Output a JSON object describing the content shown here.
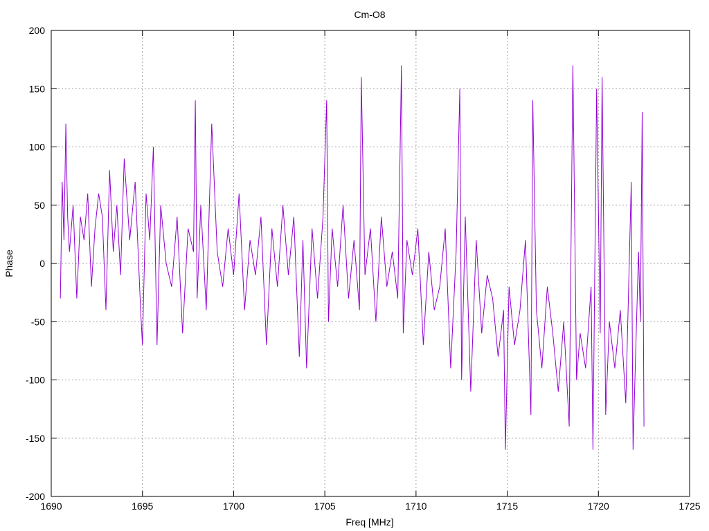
{
  "chart_data": {
    "type": "line",
    "title": "Cm-O8",
    "xlabel": "Freq [MHz]",
    "ylabel": "Phase",
    "xlim": [
      1690,
      1725
    ],
    "ylim": [
      -200,
      200
    ],
    "x_ticks": [
      1690,
      1695,
      1700,
      1705,
      1710,
      1715,
      1720,
      1725
    ],
    "y_ticks": [
      -200,
      -150,
      -100,
      -50,
      0,
      50,
      100,
      150,
      200
    ],
    "grid": true,
    "legend": "none",
    "line_color": "#9400d3",
    "series": [
      {
        "x": [
          1690.5,
          1690.6,
          1690.7,
          1690.8,
          1690.9,
          1691.0,
          1691.2,
          1691.4,
          1691.6,
          1691.8,
          1692.0,
          1692.2,
          1692.4,
          1692.6,
          1692.8,
          1693.0,
          1693.2,
          1693.4,
          1693.6,
          1693.8,
          1694.0,
          1694.3,
          1694.6,
          1694.9,
          1695.0,
          1695.2,
          1695.4,
          1695.6,
          1695.8,
          1696.0,
          1696.3,
          1696.6,
          1696.9,
          1697.2,
          1697.5,
          1697.8,
          1697.9,
          1698.0,
          1698.2,
          1698.5,
          1698.8,
          1699.1,
          1699.4,
          1699.7,
          1700.0,
          1700.3,
          1700.6,
          1700.9,
          1701.2,
          1701.5,
          1701.8,
          1702.1,
          1702.4,
          1702.7,
          1703.0,
          1703.3,
          1703.6,
          1703.8,
          1704.0,
          1704.3,
          1704.6,
          1704.9,
          1705.1,
          1705.2,
          1705.4,
          1705.7,
          1706.0,
          1706.3,
          1706.6,
          1706.9,
          1707.0,
          1707.2,
          1707.5,
          1707.8,
          1708.1,
          1708.4,
          1708.7,
          1709.0,
          1709.2,
          1709.3,
          1709.5,
          1709.8,
          1710.1,
          1710.4,
          1710.7,
          1711.0,
          1711.3,
          1711.6,
          1711.9,
          1712.2,
          1712.4,
          1712.5,
          1712.7,
          1713.0,
          1713.3,
          1713.6,
          1713.9,
          1714.2,
          1714.5,
          1714.8,
          1714.9,
          1715.1,
          1715.4,
          1715.7,
          1716.0,
          1716.3,
          1716.4,
          1716.6,
          1716.9,
          1717.2,
          1717.5,
          1717.8,
          1718.1,
          1718.4,
          1718.6,
          1718.8,
          1719.0,
          1719.3,
          1719.6,
          1719.7,
          1719.9,
          1720.1,
          1720.2,
          1720.4,
          1720.6,
          1720.9,
          1721.2,
          1721.5,
          1721.8,
          1721.9,
          1722.0,
          1722.2,
          1722.3,
          1722.4,
          1722.5
        ],
        "y": [
          -30,
          70,
          20,
          120,
          40,
          10,
          50,
          -30,
          40,
          20,
          60,
          -20,
          30,
          60,
          40,
          -40,
          80,
          10,
          50,
          -10,
          90,
          20,
          70,
          -40,
          -70,
          60,
          20,
          100,
          -70,
          50,
          0,
          -20,
          40,
          -60,
          30,
          10,
          140,
          -30,
          50,
          -40,
          120,
          10,
          -20,
          30,
          -10,
          60,
          -40,
          20,
          -10,
          40,
          -70,
          30,
          -20,
          50,
          -10,
          40,
          -80,
          20,
          -90,
          30,
          -30,
          40,
          140,
          -50,
          30,
          -20,
          50,
          -30,
          20,
          -40,
          160,
          -10,
          30,
          -50,
          40,
          -20,
          10,
          -30,
          170,
          -60,
          20,
          -10,
          30,
          -70,
          10,
          -40,
          -20,
          30,
          -90,
          10,
          150,
          -100,
          40,
          -110,
          20,
          -60,
          -10,
          -30,
          -80,
          -40,
          -160,
          -20,
          -70,
          -40,
          20,
          -130,
          140,
          -40,
          -90,
          -20,
          -60,
          -110,
          -50,
          -140,
          170,
          -100,
          -60,
          -90,
          -20,
          -160,
          150,
          -60,
          160,
          -130,
          -50,
          -90,
          -40,
          -120,
          70,
          -160,
          -100,
          10,
          -50,
          130,
          -140
        ]
      }
    ]
  }
}
